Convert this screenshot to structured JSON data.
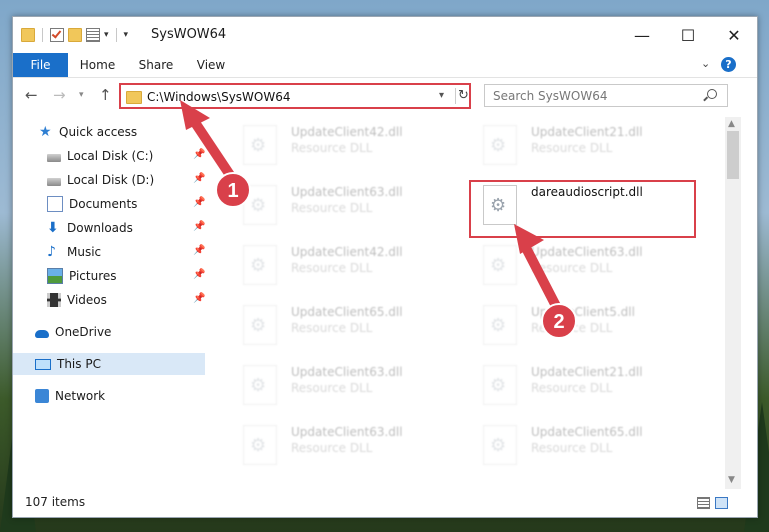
{
  "window": {
    "title": "SysWOW64",
    "minimize_glyph": "—",
    "maximize_glyph": "☐",
    "close_glyph": "✕"
  },
  "ribbon": {
    "tabs": [
      "File",
      "Home",
      "Share",
      "View"
    ],
    "help_glyph": "?",
    "collapse_glyph": "⌄"
  },
  "navigation": {
    "back_glyph": "←",
    "forward_glyph": "→",
    "up_glyph": "↑",
    "address": "C:\\Windows\\SysWOW64",
    "search_placeholder": "Search SysWOW64"
  },
  "sidebar": {
    "items": [
      {
        "label": "Quick access",
        "icon": "star-icon",
        "pinned": false
      },
      {
        "label": "Local Disk (C:)",
        "icon": "disk-icon",
        "pinned": true
      },
      {
        "label": "Local Disk (D:)",
        "icon": "disk-icon",
        "pinned": true
      },
      {
        "label": "Documents",
        "icon": "documents-icon",
        "pinned": true
      },
      {
        "label": "Downloads",
        "icon": "downloads-icon",
        "pinned": true
      },
      {
        "label": "Music",
        "icon": "music-icon",
        "pinned": true
      },
      {
        "label": "Pictures",
        "icon": "pictures-icon",
        "pinned": true
      },
      {
        "label": "Videos",
        "icon": "videos-icon",
        "pinned": true
      },
      {
        "label": "OneDrive",
        "icon": "onedrive-icon",
        "pinned": false
      },
      {
        "label": "This PC",
        "icon": "this-pc-icon",
        "pinned": false,
        "selected": true
      },
      {
        "label": "Network",
        "icon": "network-icon",
        "pinned": false
      }
    ],
    "pin_glyph": "📌"
  },
  "files": [
    {
      "name": "UpdateClient42.dll",
      "type": "Resource DLL",
      "faded": true
    },
    {
      "name": "UpdateClient21.dll",
      "type": "Resource DLL",
      "faded": true
    },
    {
      "name": "UpdateClient63.dll",
      "type": "Resource DLL",
      "faded": true
    },
    {
      "name": "dareaudioscript.dll",
      "type": "",
      "faded": false,
      "highlighted": true
    },
    {
      "name": "UpdateClient42.dll",
      "type": "Resource DLL",
      "faded": true
    },
    {
      "name": "UpdateClient63.dll",
      "type": "Resource DLL",
      "faded": true
    },
    {
      "name": "UpdateClient65.dll",
      "type": "Resource DLL",
      "faded": true
    },
    {
      "name": "UpdateClient5.dll",
      "type": "Resource DLL",
      "faded": true
    },
    {
      "name": "UpdateClient63.dll",
      "type": "Resource DLL",
      "faded": true
    },
    {
      "name": "UpdateClient21.dll",
      "type": "Resource DLL",
      "faded": true
    },
    {
      "name": "UpdateClient63.dll",
      "type": "Resource DLL",
      "faded": true
    },
    {
      "name": "UpdateClient65.dll",
      "type": "Resource DLL",
      "faded": true
    }
  ],
  "status": {
    "item_count": "107 items"
  },
  "annotations": {
    "step1": "1",
    "step2": "2",
    "color": "#d9404a"
  }
}
